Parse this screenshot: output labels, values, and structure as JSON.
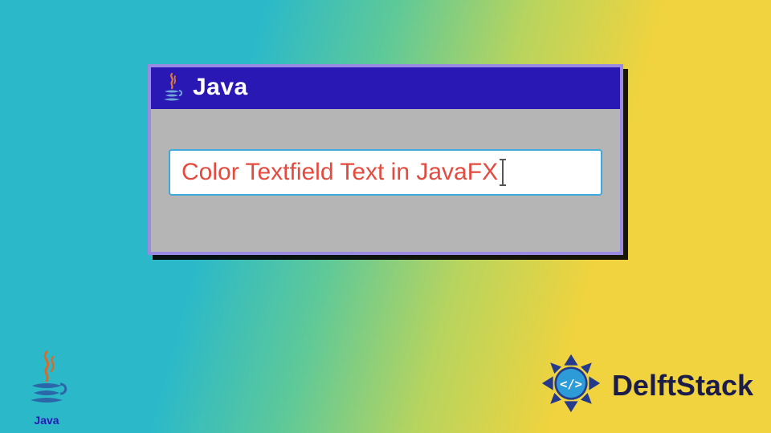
{
  "window": {
    "title": "Java",
    "textfield_value": "Color Textfield Text in JavaFX"
  },
  "branding": {
    "bottom_left_label": "Java",
    "bottom_right_label": "DelftStack"
  },
  "colors": {
    "titlebar_bg": "#2a18b5",
    "window_border": "#9a8ae2",
    "client_bg": "#b5b5b5",
    "textfield_border": "#3fa9db",
    "textfield_text": "#e44a3e"
  },
  "icons": {
    "titlebar_icon": "java-logo-icon",
    "bottom_left_icon": "java-logo-icon",
    "bottom_right_icon": "delftstack-logo-icon"
  }
}
